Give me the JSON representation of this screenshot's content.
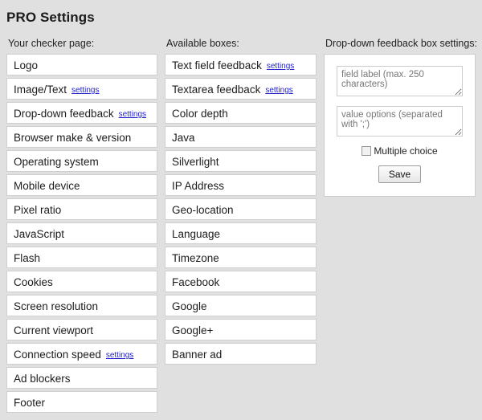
{
  "page": {
    "title": "PRO Settings",
    "background_color": "#e0e0e0"
  },
  "link_color": "#2222cc",
  "columns": {
    "checker": {
      "heading": "Your checker page:",
      "items": [
        {
          "label": "Logo",
          "settings_link": ""
        },
        {
          "label": "Image/Text",
          "settings_link": "settings"
        },
        {
          "label": "Drop-down feedback",
          "settings_link": "settings"
        },
        {
          "label": "Browser make & version",
          "settings_link": ""
        },
        {
          "label": "Operating system",
          "settings_link": ""
        },
        {
          "label": "Mobile device",
          "settings_link": ""
        },
        {
          "label": "Pixel ratio",
          "settings_link": ""
        },
        {
          "label": "JavaScript",
          "settings_link": ""
        },
        {
          "label": "Flash",
          "settings_link": ""
        },
        {
          "label": "Cookies",
          "settings_link": ""
        },
        {
          "label": "Screen resolution",
          "settings_link": ""
        },
        {
          "label": "Current viewport",
          "settings_link": ""
        },
        {
          "label": "Connection speed",
          "settings_link": "settings"
        },
        {
          "label": "Ad blockers",
          "settings_link": ""
        },
        {
          "label": "Footer",
          "settings_link": ""
        }
      ]
    },
    "available": {
      "heading": "Available boxes:",
      "items": [
        {
          "label": "Text field feedback",
          "settings_link": "settings"
        },
        {
          "label": "Textarea feedback",
          "settings_link": "settings"
        },
        {
          "label": "Color depth",
          "settings_link": ""
        },
        {
          "label": "Java",
          "settings_link": ""
        },
        {
          "label": "Silverlight",
          "settings_link": ""
        },
        {
          "label": "IP Address",
          "settings_link": ""
        },
        {
          "label": "Geo-location",
          "settings_link": ""
        },
        {
          "label": "Language",
          "settings_link": ""
        },
        {
          "label": "Timezone",
          "settings_link": ""
        },
        {
          "label": "Facebook",
          "settings_link": ""
        },
        {
          "label": "Google",
          "settings_link": ""
        },
        {
          "label": "Google+",
          "settings_link": ""
        },
        {
          "label": "Banner ad",
          "settings_link": ""
        }
      ]
    },
    "settings_panel": {
      "heading": "Drop-down feedback box settings:",
      "field_label": {
        "value": "",
        "placeholder": "field label (max. 250 characters)"
      },
      "value_options": {
        "value": "",
        "placeholder": "value options (separated with ';')"
      },
      "multiple_choice": {
        "label": "Multiple choice",
        "checked": false
      },
      "save_label": "Save"
    }
  }
}
